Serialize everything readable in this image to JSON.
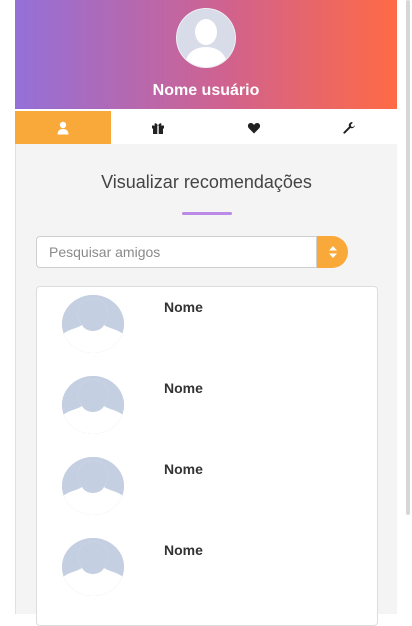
{
  "profile": {
    "username": "Nome usuário",
    "gradient": [
      "#9470d8",
      "#ff6a45"
    ],
    "avatar_icon": "avatar-silhouette-icon"
  },
  "tabs": [
    {
      "icon": "user-icon",
      "active": true
    },
    {
      "icon": "gift-icon",
      "active": false
    },
    {
      "icon": "heart-icon",
      "active": false
    },
    {
      "icon": "wrench-icon",
      "active": false
    }
  ],
  "accent_color": "#f8a93a",
  "panel": {
    "title": "Visualizar recomendações",
    "underline_color": "#b98be6"
  },
  "search": {
    "placeholder": "Pesquisar amigos",
    "value": "",
    "sort_icon": "sort-icon"
  },
  "friends": [
    {
      "name": "Nome"
    },
    {
      "name": "Nome"
    },
    {
      "name": "Nome"
    },
    {
      "name": "Nome"
    }
  ]
}
